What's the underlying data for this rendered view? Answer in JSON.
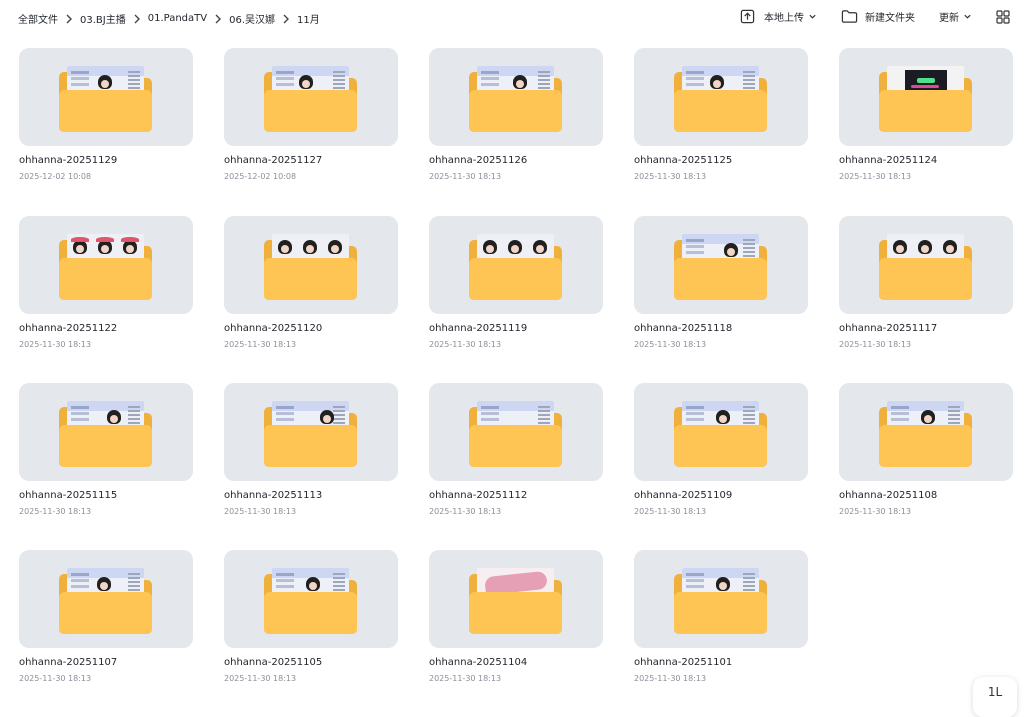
{
  "breadcrumb": [
    "全部文件",
    "03.BJ主播",
    "01.PandaTV",
    "06.吴汉娜",
    "11月"
  ],
  "toolbar": {
    "upload_label": "本地上传",
    "new_folder_label": "新建文件夹",
    "sort_label": "更新"
  },
  "float_button_label": "1L",
  "folders": [
    {
      "name": "ohhanna-20251129",
      "date": "2025-12-02 10:08"
    },
    {
      "name": "ohhanna-20251127",
      "date": "2025-12-02 10:08"
    },
    {
      "name": "ohhanna-20251126",
      "date": "2025-11-30 18:13"
    },
    {
      "name": "ohhanna-20251125",
      "date": "2025-11-30 18:13"
    },
    {
      "name": "ohhanna-20251124",
      "date": "2025-11-30 18:13"
    },
    {
      "name": "ohhanna-20251122",
      "date": "2025-11-30 18:13"
    },
    {
      "name": "ohhanna-20251120",
      "date": "2025-11-30 18:13"
    },
    {
      "name": "ohhanna-20251119",
      "date": "2025-11-30 18:13"
    },
    {
      "name": "ohhanna-20251118",
      "date": "2025-11-30 18:13"
    },
    {
      "name": "ohhanna-20251117",
      "date": "2025-11-30 18:13"
    },
    {
      "name": "ohhanna-20251115",
      "date": "2025-11-30 18:13"
    },
    {
      "name": "ohhanna-20251113",
      "date": "2025-11-30 18:13"
    },
    {
      "name": "ohhanna-20251112",
      "date": "2025-11-30 18:13"
    },
    {
      "name": "ohhanna-20251109",
      "date": "2025-11-30 18:13"
    },
    {
      "name": "ohhanna-20251108",
      "date": "2025-11-30 18:13"
    },
    {
      "name": "ohhanna-20251107",
      "date": "2025-11-30 18:13"
    },
    {
      "name": "ohhanna-20251105",
      "date": "2025-11-30 18:13"
    },
    {
      "name": "ohhanna-20251104",
      "date": "2025-11-30 18:13"
    },
    {
      "name": "ohhanna-20251101",
      "date": "2025-11-30 18:13"
    }
  ]
}
